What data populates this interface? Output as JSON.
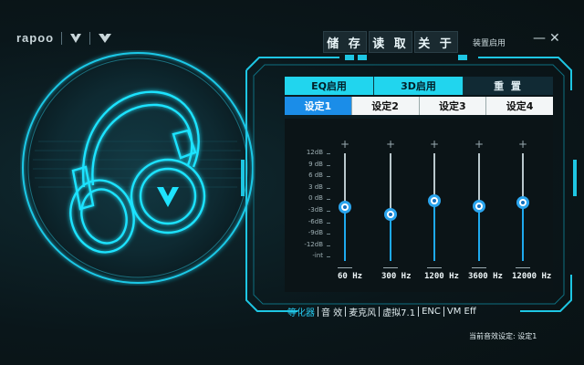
{
  "brand": {
    "name": "rapoo"
  },
  "top_buttons": [
    "储 存",
    "读 取",
    "关 于"
  ],
  "install_label": "装置启用",
  "window": {
    "minimize": "—",
    "close": "✕"
  },
  "tabs_row1": [
    {
      "label": "EQ启用",
      "active": true
    },
    {
      "label": "3D启用",
      "active": true
    },
    {
      "label": "重 置",
      "active": false
    }
  ],
  "tabs_row2": [
    {
      "label": "设定1",
      "active": true
    },
    {
      "label": "设定2",
      "active": false
    },
    {
      "label": "设定3",
      "active": false
    },
    {
      "label": "设定4",
      "active": false
    }
  ],
  "db_scale": [
    "12dB",
    "9 dB",
    "6 dB",
    "3 dB",
    "0 dB",
    "-3dB",
    "-6dB",
    "-9dB",
    "-12dB",
    "-int"
  ],
  "sliders": [
    {
      "freq": "60 Hz",
      "level": 0.5
    },
    {
      "freq": "300 Hz",
      "level": 0.43
    },
    {
      "freq": "1200 Hz",
      "level": 0.56
    },
    {
      "freq": "3600 Hz",
      "level": 0.51
    },
    {
      "freq": "12000 Hz",
      "level": 0.54
    }
  ],
  "bottom_nav": [
    {
      "label": "等化器",
      "active": true
    },
    {
      "label": "音 效",
      "active": false
    },
    {
      "label": "麦克风",
      "active": false
    },
    {
      "label": "虚拟7.1",
      "active": false
    },
    {
      "label": "ENC",
      "active": false
    },
    {
      "label": "VM Eff",
      "active": false
    }
  ],
  "current_setting": "当前音效设定: 设定1",
  "colors": {
    "accent": "#21d5ee",
    "selected": "#1b8de8",
    "bg": "#0a1418"
  }
}
